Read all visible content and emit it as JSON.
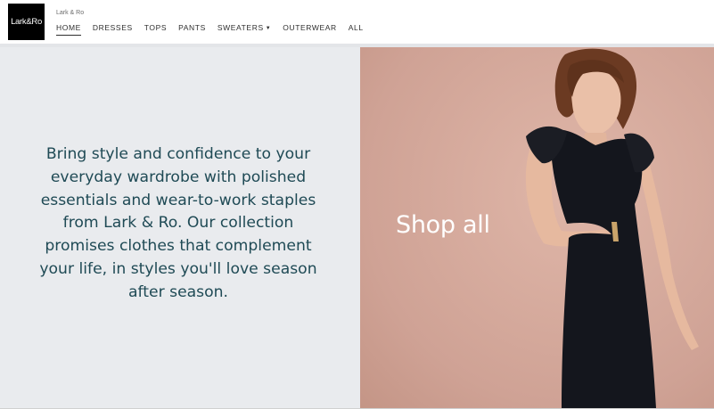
{
  "header": {
    "logo_text": "Lark&Ro",
    "brand_label": "Lark & Ro",
    "nav": [
      {
        "label": "HOME",
        "active": true
      },
      {
        "label": "DRESSES"
      },
      {
        "label": "TOPS"
      },
      {
        "label": "PANTS"
      },
      {
        "label": "SWEATERS",
        "dropdown": true
      },
      {
        "label": "OUTERWEAR"
      },
      {
        "label": "ALL"
      }
    ]
  },
  "main": {
    "tagline": "Bring style and confidence to your everyday wardrobe with polished essentials and wear-to-work staples from Lark & Ro. Our collection promises clothes that complement your life, in styles you'll love season after season.",
    "hero_cta": "Shop all"
  },
  "colors": {
    "tagline_text": "#1f4a55",
    "left_bg": "#e9ebee",
    "hero_bg": "#d9aea1"
  }
}
